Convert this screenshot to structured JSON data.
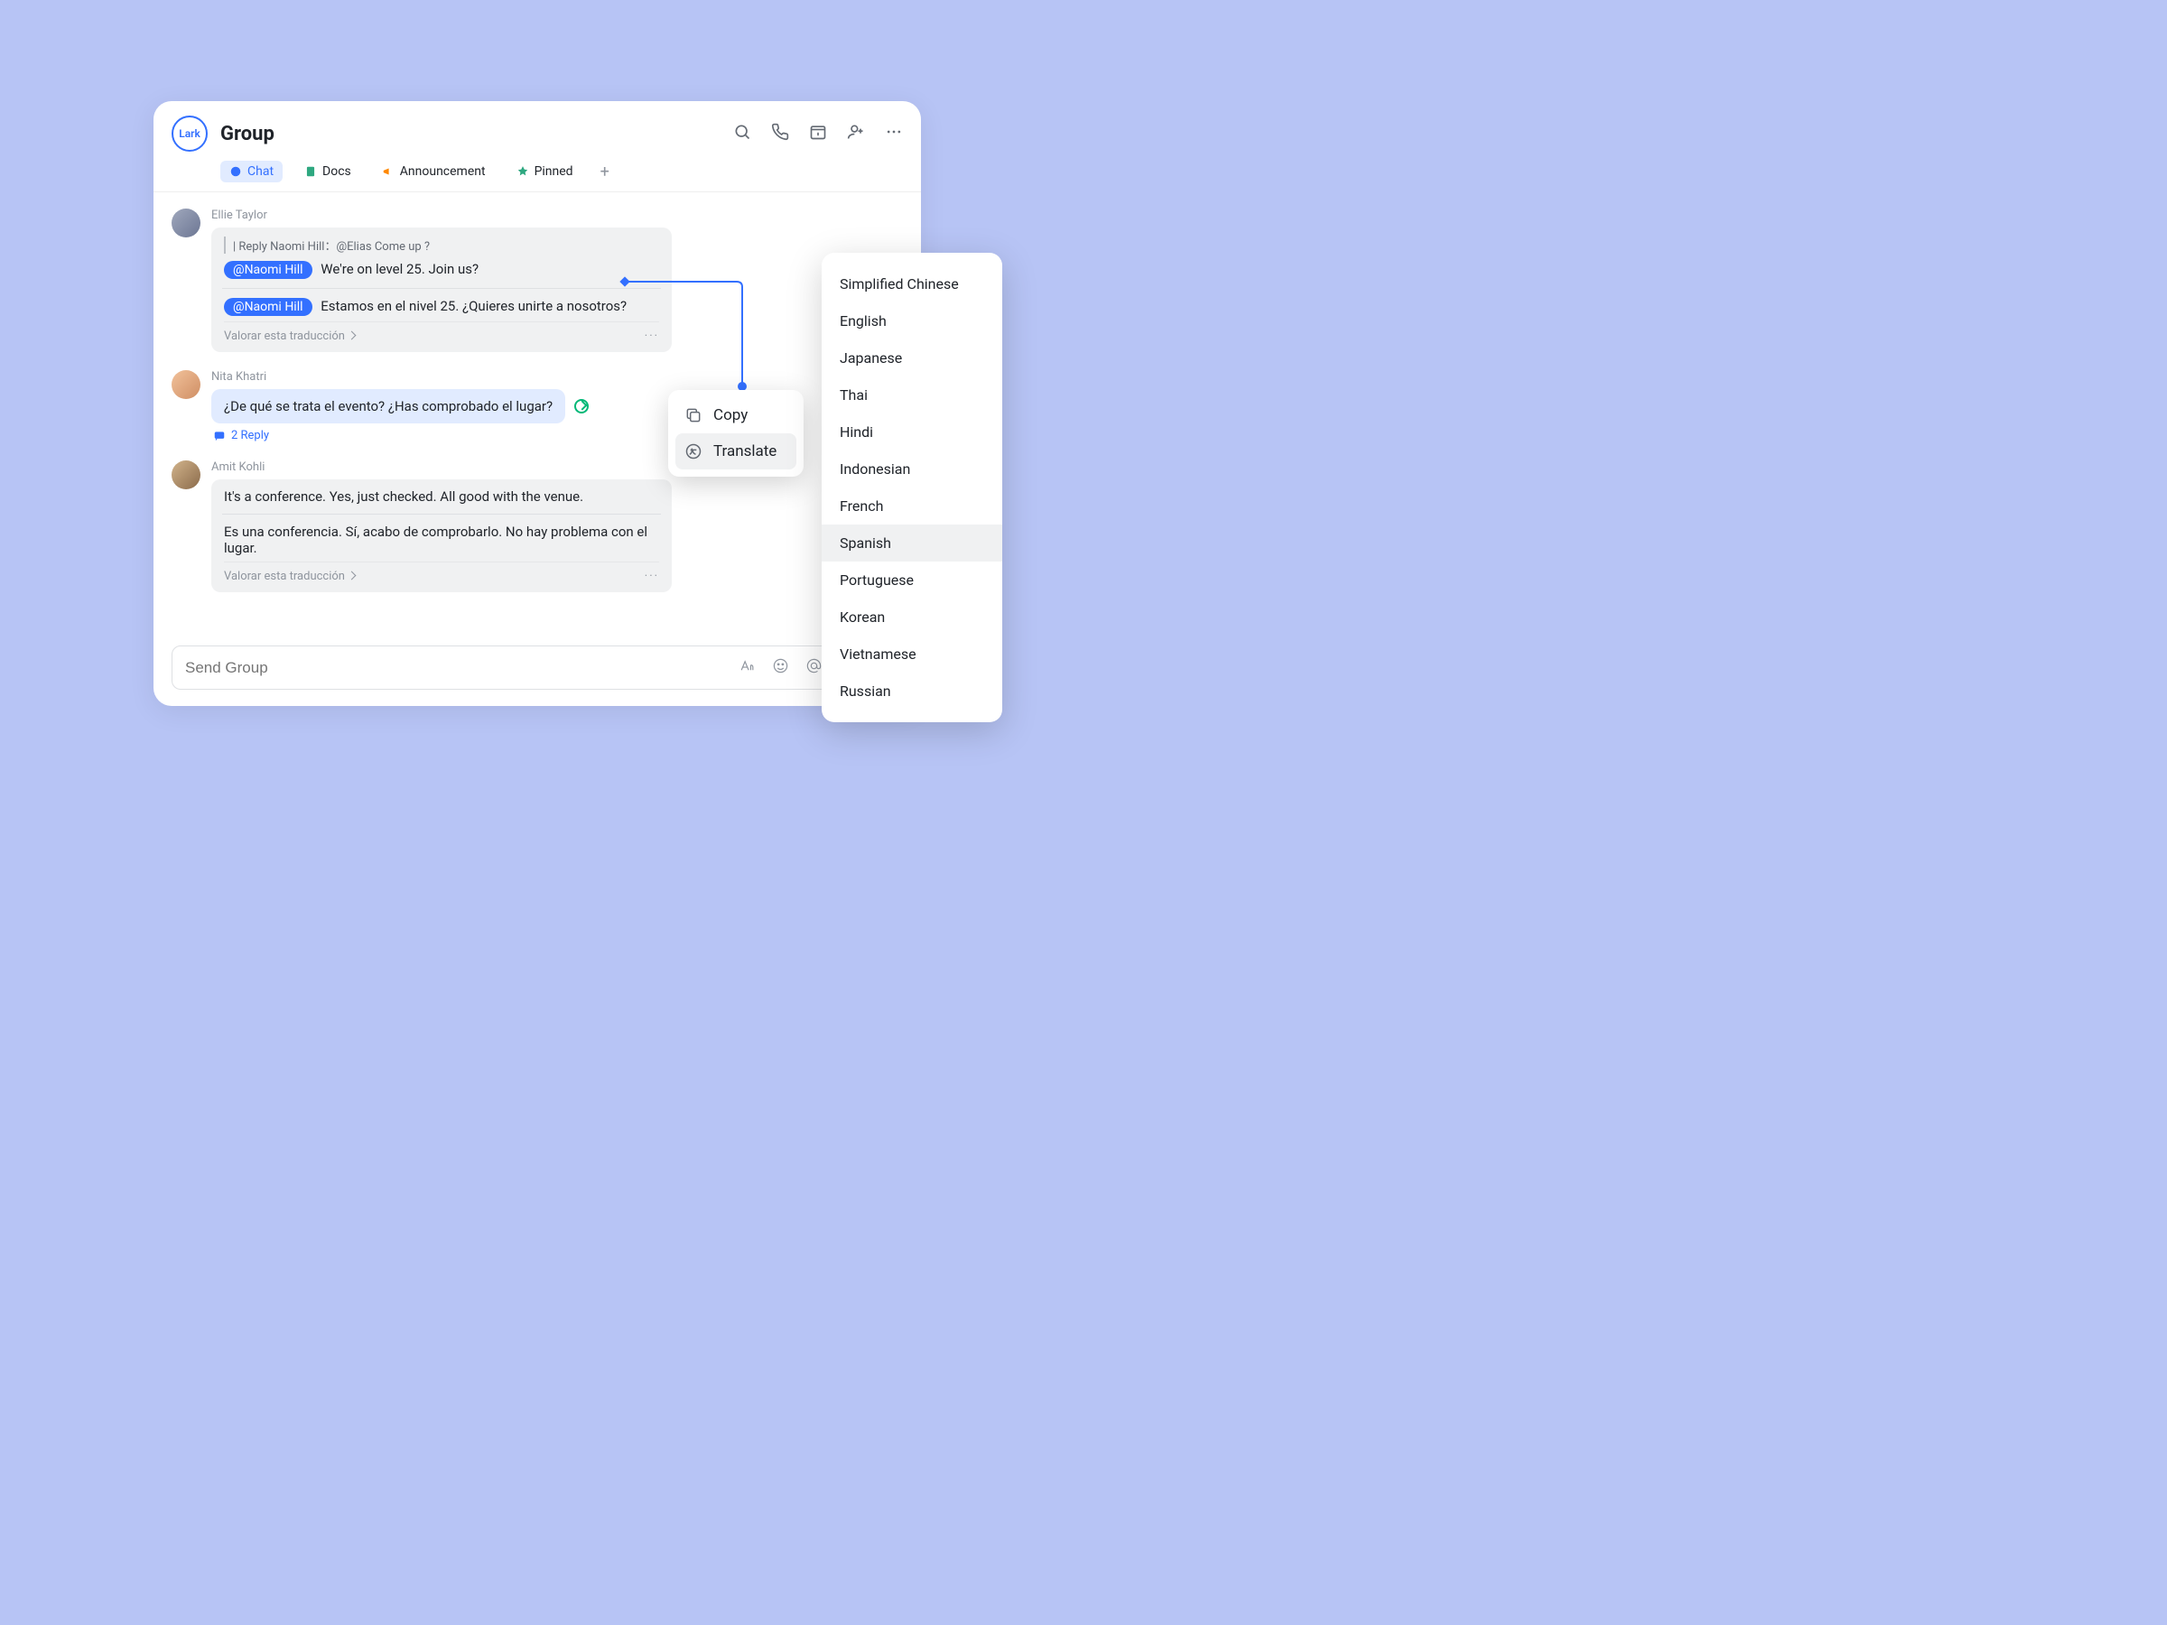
{
  "header": {
    "logo_text": "Lark",
    "title": "Group",
    "tabs": [
      {
        "label": "Chat",
        "icon": "chat-icon",
        "active": true
      },
      {
        "label": "Docs",
        "icon": "docs-icon",
        "active": false
      },
      {
        "label": "Announcement",
        "icon": "announcement-icon",
        "active": false
      },
      {
        "label": "Pinned",
        "icon": "pinned-icon",
        "active": false
      }
    ],
    "toolbar_icons": [
      "search-icon",
      "call-icon",
      "calendar-icon",
      "add-user-icon",
      "more-icon"
    ]
  },
  "messages": [
    {
      "author": "Ellie Taylor",
      "reply_quote": "| Reply Naomi Hill：@Elias Come up ?",
      "mention": "@Naomi Hill",
      "text_original": "We're on level 25. Join us?",
      "text_translated": "Estamos en el nivel 25. ¿Quieres unirte a nosotros?",
      "rate_label": "Valorar esta traducción"
    },
    {
      "author": "Nita Khatri",
      "text": "¿De qué se trata el evento? ¿Has comprobado el lugar?",
      "reply_count_label": "2 Reply"
    },
    {
      "author": "Amit Kohli",
      "text_original": "It's a conference. Yes, just checked. All good with the venue.",
      "text_translated": "Es una conferencia. Sí, acabo de comprobarlo. No hay problema con el lugar.",
      "rate_label": "Valorar esta traducción"
    }
  ],
  "composer": {
    "placeholder": "Send Group",
    "icons": [
      "font-icon",
      "emoji-icon",
      "mention-icon",
      "scissors-icon",
      "plus-icon"
    ]
  },
  "context_menu": {
    "items": [
      {
        "label": "Copy",
        "icon": "copy-icon",
        "hover": false
      },
      {
        "label": "Translate",
        "icon": "translate-icon",
        "hover": true
      }
    ]
  },
  "language_menu": {
    "selected": "Spanish",
    "items": [
      "Simplified Chinese",
      "English",
      "Japanese",
      "Thai",
      "Hindi",
      "Indonesian",
      "French",
      "Spanish",
      "Portuguese",
      "Korean",
      "Vietnamese",
      "Russian"
    ]
  },
  "colors": {
    "accent": "#3370ff",
    "success": "#00b877",
    "bg": "#b7c4f5"
  }
}
